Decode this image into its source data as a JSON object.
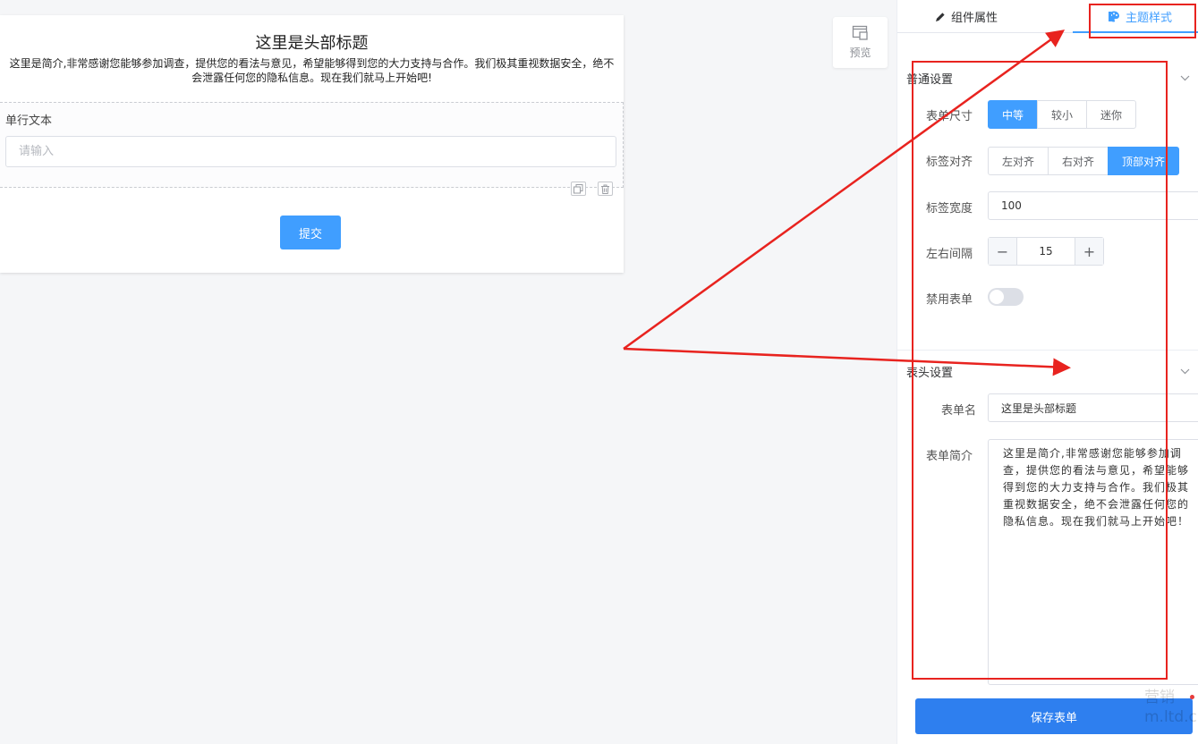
{
  "form": {
    "title": "这里是头部标题",
    "description": "这里是简介,非常感谢您能够参加调查，提供您的看法与意见，希望能够得到您的大力支持与合作。我们极其重视数据安全，绝不会泄露任何您的隐私信息。现在我们就马上开始吧!",
    "field_label": "单行文本",
    "field_placeholder": "请输入",
    "submit_label": "提交"
  },
  "preview": {
    "label": "预览",
    "icon": "preview-icon"
  },
  "tabs": [
    {
      "label": "组件属性",
      "icon": "pencil-icon",
      "active": false
    },
    {
      "label": "主题样式",
      "icon": "palette-icon",
      "active": true
    }
  ],
  "general": {
    "title": "普通设置",
    "form_size": {
      "label": "表单尺寸",
      "options": [
        "中等",
        "较小",
        "迷你"
      ],
      "selected": "中等"
    },
    "label_align": {
      "label": "标签对齐",
      "options": [
        "左对齐",
        "右对齐",
        "顶部对齐"
      ],
      "selected": "顶部对齐"
    },
    "label_width": {
      "label": "标签宽度",
      "value": "100"
    },
    "gutter": {
      "label": "左右间隔",
      "value": "15"
    },
    "disabled": {
      "label": "禁用表单",
      "on": false
    }
  },
  "header_settings": {
    "title": "表头设置",
    "form_name": {
      "label": "表单名",
      "value": "这里是头部标题"
    },
    "form_desc": {
      "label": "表单简介",
      "value": "这里是简介,非常感谢您能够参加调查，提供您的看法与意见，希望能够得到您的大力支持与合作。我们极其重视数据安全，绝不会泄露任何您的隐私信息。现在我们就马上开始吧！"
    }
  },
  "save_label": "保存表单",
  "watermark": "营销\nm.ltd.c",
  "colors": {
    "primary": "#409eff",
    "save": "#2e7fef",
    "annotation": "#e8231f"
  }
}
